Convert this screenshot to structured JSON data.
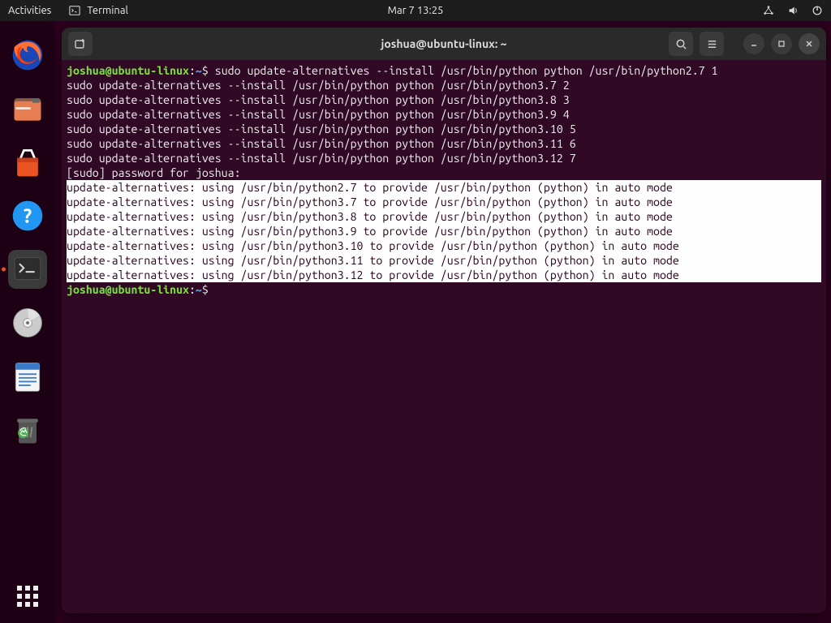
{
  "panel": {
    "activities": "Activities",
    "app_name": "Terminal",
    "datetime": "Mar 7  13:25"
  },
  "dock": {
    "items": [
      {
        "name": "firefox"
      },
      {
        "name": "files"
      },
      {
        "name": "software"
      },
      {
        "name": "help"
      },
      {
        "name": "terminal",
        "active": true
      },
      {
        "name": "disc"
      },
      {
        "name": "text-editor"
      },
      {
        "name": "trash"
      }
    ]
  },
  "window": {
    "title": "joshua@ubuntu-linux: ~"
  },
  "terminal": {
    "prompt_user": "joshua@ubuntu-linux",
    "prompt_sep": ":",
    "prompt_path": "~",
    "prompt_dollar": "$",
    "lines": {
      "cmd1": "sudo update-alternatives --install /usr/bin/python python /usr/bin/python2.7 1",
      "cmd2": "sudo update-alternatives --install /usr/bin/python python /usr/bin/python3.7 2",
      "cmd3": "sudo update-alternatives --install /usr/bin/python python /usr/bin/python3.8 3",
      "cmd4": "sudo update-alternatives --install /usr/bin/python python /usr/bin/python3.9 4",
      "cmd5": "sudo update-alternatives --install /usr/bin/python python /usr/bin/python3.10 5",
      "cmd6": "sudo update-alternatives --install /usr/bin/python python /usr/bin/python3.11 6",
      "cmd7": "sudo update-alternatives --install /usr/bin/python python /usr/bin/python3.12 7",
      "sudo_prompt": "[sudo] password for joshua:",
      "out1": "update-alternatives: using /usr/bin/python2.7 to provide /usr/bin/python (python) in auto mode",
      "out2": "update-alternatives: using /usr/bin/python3.7 to provide /usr/bin/python (python) in auto mode",
      "out3": "update-alternatives: using /usr/bin/python3.8 to provide /usr/bin/python (python) in auto mode",
      "out4": "update-alternatives: using /usr/bin/python3.9 to provide /usr/bin/python (python) in auto mode",
      "out5": "update-alternatives: using /usr/bin/python3.10 to provide /usr/bin/python (python) in auto mode",
      "out6": "update-alternatives: using /usr/bin/python3.11 to provide /usr/bin/python (python) in auto mode",
      "out7": "update-alternatives: using /usr/bin/python3.12 to provide /usr/bin/python (python) in auto mode"
    }
  }
}
